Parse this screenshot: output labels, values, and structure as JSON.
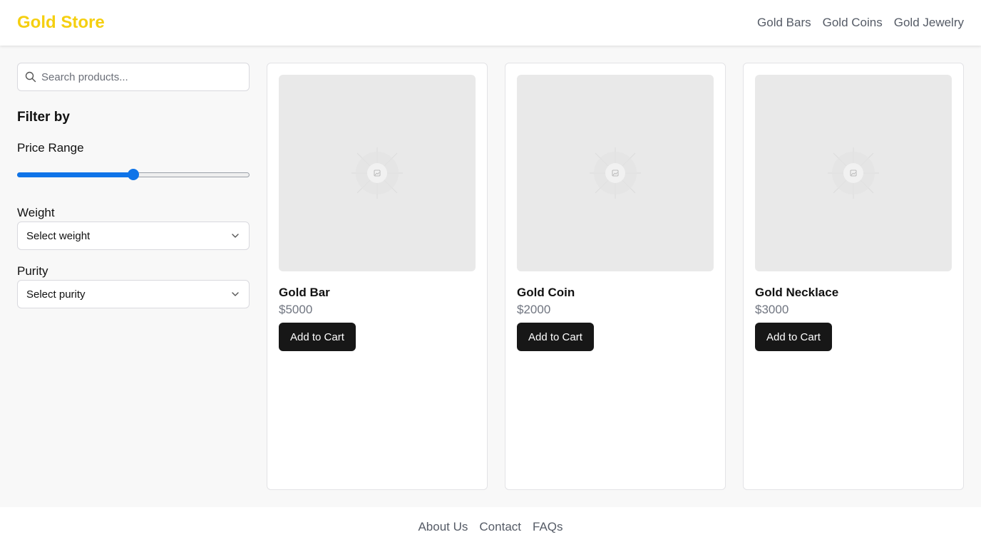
{
  "header": {
    "brand": "Gold Store",
    "nav": [
      "Gold Bars",
      "Gold Coins",
      "Gold Jewelry"
    ]
  },
  "sidebar": {
    "search_placeholder": "Search products...",
    "filter_title": "Filter by",
    "price_label": "Price Range",
    "price_value_fraction": 0.5,
    "weight_label": "Weight",
    "weight_select": "Select weight",
    "purity_label": "Purity",
    "purity_select": "Select purity"
  },
  "products": [
    {
      "name": "Gold Bar",
      "price": "$5000",
      "button": "Add to Cart"
    },
    {
      "name": "Gold Coin",
      "price": "$2000",
      "button": "Add to Cart"
    },
    {
      "name": "Gold Necklace",
      "price": "$3000",
      "button": "Add to Cart"
    }
  ],
  "footer": {
    "links": [
      "About Us",
      "Contact",
      "FAQs"
    ]
  },
  "colors": {
    "brand": "#f5cf10",
    "slider": "#0f74e8",
    "button_bg": "#171717"
  },
  "icons": {
    "search": "search-icon",
    "chevron": "chevron-down-icon",
    "image_placeholder": "image-placeholder-icon"
  }
}
